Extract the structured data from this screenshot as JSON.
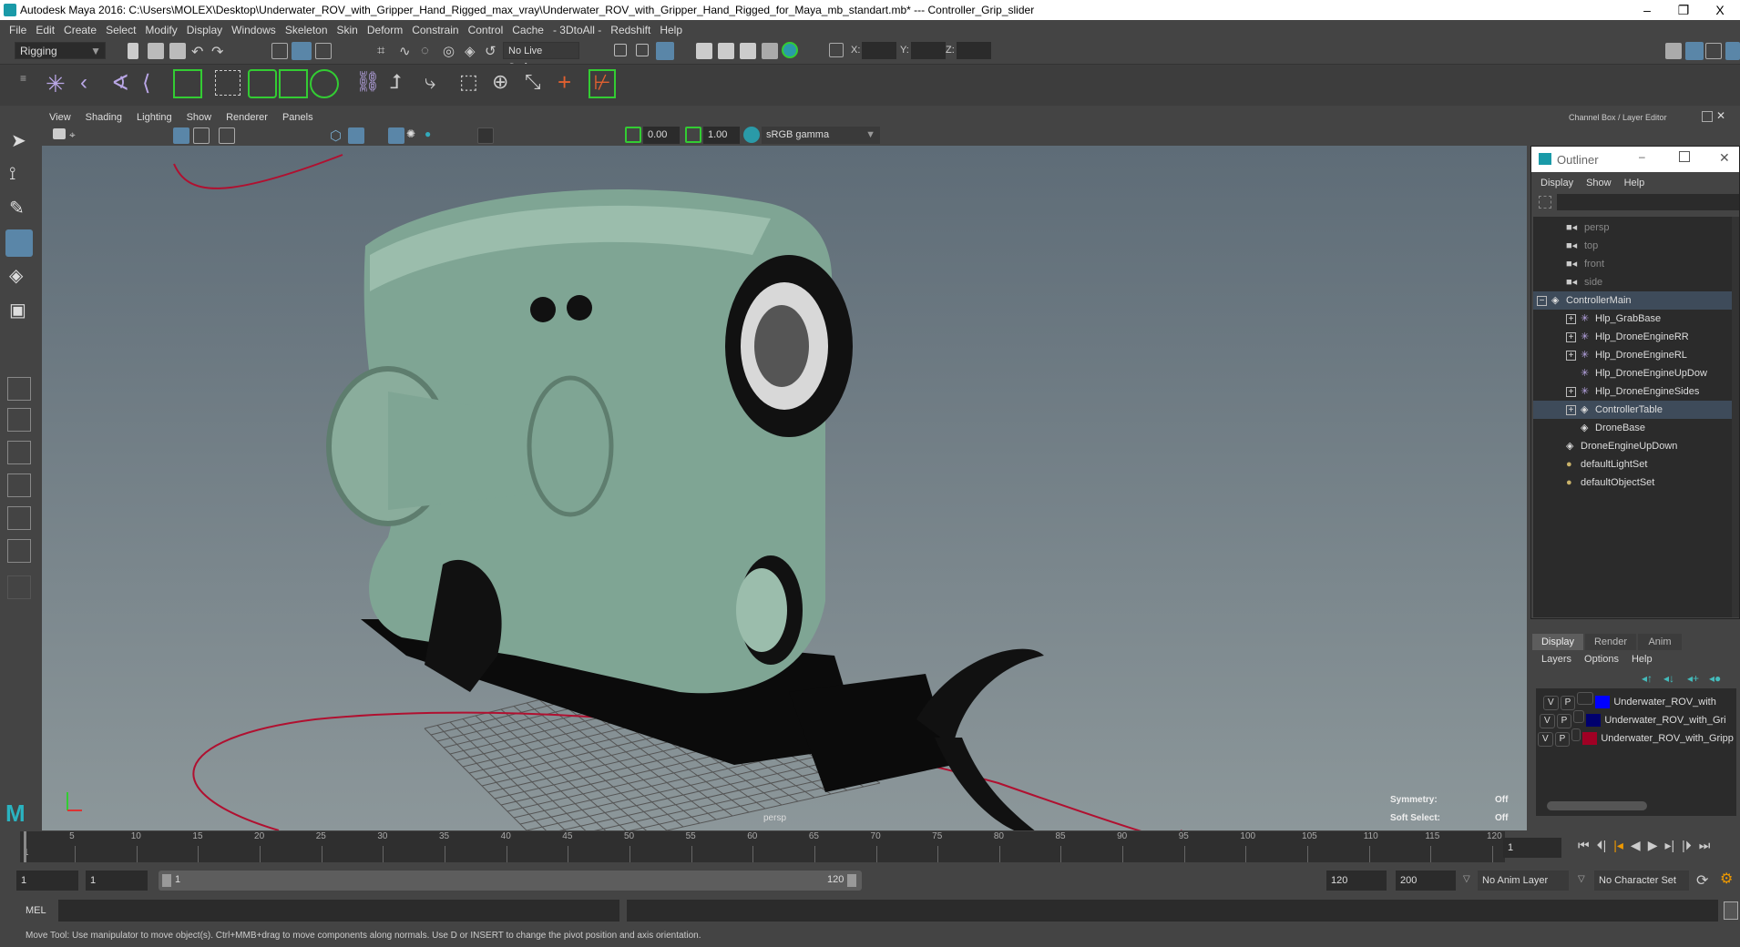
{
  "window": {
    "title": "Autodesk Maya 2016: C:\\Users\\MOLEX\\Desktop\\Underwater_ROV_with_Gripper_Hand_Rigged_max_vray\\Underwater_ROV_with_Gripper_Hand_Rigged_for_Maya_mb_standart.mb*  ---  Controller_Grip_slider",
    "minimize": "–",
    "restore": "❐",
    "close": "X"
  },
  "menubar": [
    "File",
    "Edit",
    "Create",
    "Select",
    "Modify",
    "Display",
    "Windows",
    "Skeleton",
    "Skin",
    "Deform",
    "Constrain",
    "Control",
    "Cache",
    "- 3DtoAll -",
    "Redshift",
    "Help"
  ],
  "statusline": {
    "menuset": "Rigging",
    "live_surface": "No Live Surface",
    "x_label": "X:",
    "y_label": "Y:",
    "z_label": "Z:"
  },
  "viewport": {
    "menu": [
      "View",
      "Shading",
      "Lighting",
      "Show",
      "Renderer",
      "Panels"
    ],
    "exposure": "0.00",
    "gamma": "1.00",
    "color_space": "sRGB gamma",
    "camera": "persp",
    "symmetry_label": "Symmetry:",
    "symmetry_value": "Off",
    "soft_select_label": "Soft Select:",
    "soft_select_value": "Off",
    "colors": {
      "body": "#7fa594",
      "dark": "#0b0b0b",
      "curve": "#b01030"
    }
  },
  "channel_box": {
    "title": "Channel Box / Layer Editor"
  },
  "outliner": {
    "title": "Outliner",
    "menu": [
      "Display",
      "Show",
      "Help"
    ],
    "items": [
      {
        "label": "persp",
        "icon": "camera-icon"
      },
      {
        "label": "top",
        "icon": "camera-icon"
      },
      {
        "label": "front",
        "icon": "camera-icon"
      },
      {
        "label": "side",
        "icon": "camera-icon"
      },
      {
        "label": "ControllerMain",
        "icon": "curve-icon",
        "expand": "−"
      },
      {
        "label": "Hlp_GrabBase",
        "icon": "locator-icon",
        "expand": "+"
      },
      {
        "label": "Hlp_DroneEngineRR",
        "icon": "locator-icon",
        "expand": "+"
      },
      {
        "label": "Hlp_DroneEngineRL",
        "icon": "locator-icon",
        "expand": "+"
      },
      {
        "label": "Hlp_DroneEngineUpDow",
        "icon": "locator-icon"
      },
      {
        "label": "Hlp_DroneEngineSides",
        "icon": "locator-icon",
        "expand": "+"
      },
      {
        "label": "ControllerTable",
        "icon": "curve-icon",
        "expand": "+"
      },
      {
        "label": "DroneBase",
        "icon": "curve-icon"
      },
      {
        "label": "DroneEngineUpDown",
        "icon": "curve-icon"
      },
      {
        "label": "defaultLightSet",
        "icon": "set-icon"
      },
      {
        "label": "defaultObjectSet",
        "icon": "set-icon"
      }
    ]
  },
  "layer_editor": {
    "tabs": [
      "Display",
      "Render",
      "Anim"
    ],
    "active_tab": "Display",
    "menu": [
      "Layers",
      "Options",
      "Help"
    ],
    "layers": [
      {
        "v": "V",
        "p": "P",
        "name": "Underwater_ROV_with",
        "color": "#0000ff"
      },
      {
        "v": "V",
        "p": "P",
        "name": "Underwater_ROV_with_Gri",
        "color": "#00006e"
      },
      {
        "v": "V",
        "p": "P",
        "name": "Underwater_ROV_with_Gripp",
        "color": "#a00024"
      }
    ]
  },
  "timeline": {
    "ticks": [
      "5",
      "10",
      "15",
      "20",
      "25",
      "30",
      "35",
      "40",
      "45",
      "50",
      "55",
      "60",
      "65",
      "70",
      "75",
      "80",
      "85",
      "90",
      "95",
      "100",
      "105",
      "110",
      "115",
      "120"
    ],
    "start_marker": "1",
    "current_frame": "1"
  },
  "range": {
    "start": "1",
    "playback_start": "1",
    "slider_start": "1",
    "slider_end": "120",
    "playback_end": "120",
    "end": "200",
    "anim_layer": "No Anim Layer",
    "character_set": "No Character Set"
  },
  "command": {
    "label": "MEL"
  },
  "help_line": "Move Tool: Use manipulator to move object(s). Ctrl+MMB+drag to move components along normals. Use D or INSERT to change the pivot position and axis orientation."
}
